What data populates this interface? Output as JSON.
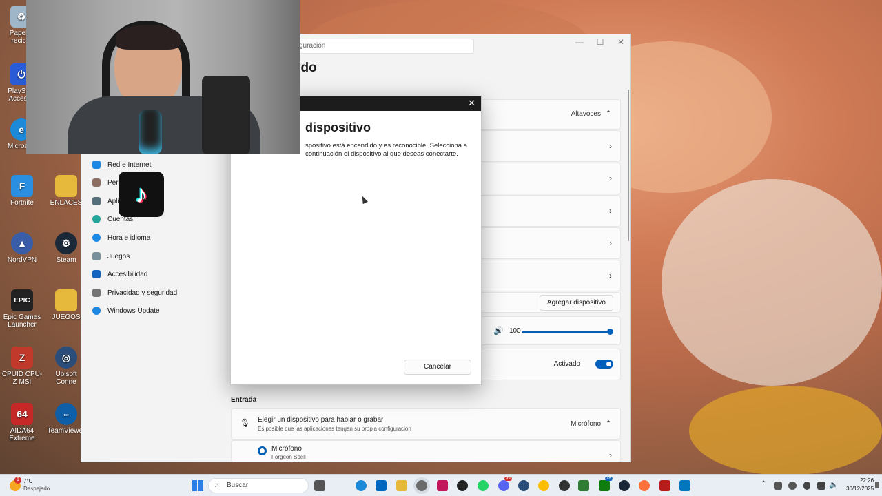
{
  "desktop": {
    "icons": [
      {
        "label": "Papelera de reciclaje",
        "short": "Papeler reciclá",
        "color": "#9fb6c9"
      },
      {
        "label": "PlayStation Accessories",
        "short": "PlayStati Accessc",
        "color": "#2a5bd7"
      },
      {
        "label": "Microsoft Edge",
        "short": "Microsofl",
        "color": "#1c8ad9"
      },
      {
        "label": "Fortnite",
        "short": "Fortnite",
        "color": "#2a8fe0"
      },
      {
        "label": "ENLACES",
        "short": "ENLACES",
        "color": "#e6b93d"
      },
      {
        "label": "NordVPN",
        "short": "NordVPN",
        "color": "#3a5da8"
      },
      {
        "label": "Steam",
        "short": "Steam",
        "color": "#1b2838"
      },
      {
        "label": "Epic Games Launcher",
        "short": "Epic Games Launcher",
        "color": "#222222"
      },
      {
        "label": "JUEGOS",
        "short": "JUEGOS",
        "color": "#e6b93d"
      },
      {
        "label": "CPUID CPU-Z MSI",
        "short": "CPUID CPU-Z MSI",
        "color": "#c0392b"
      },
      {
        "label": "Ubisoft Connect",
        "short": "Ubisoft Conne",
        "color": "#2b4d7a"
      },
      {
        "label": "AIDA64 Extreme",
        "short": "AIDA64 Extreme",
        "color": "#c62828"
      },
      {
        "label": "TeamViewer",
        "short": "TeamViewer",
        "color": "#0e5ea8"
      }
    ]
  },
  "settings": {
    "search_placeholder": "figuración",
    "page_title": "onido",
    "nav_items": [
      {
        "label": "Red e Internet",
        "color": "#1e88e5"
      },
      {
        "label": "Pers",
        "color": "#8d6e63"
      },
      {
        "label": "Aplic",
        "color": "#546e7a"
      },
      {
        "label": "Cuentas",
        "color": "#26a69a"
      },
      {
        "label": "Hora e idioma",
        "color": "#1e88e5"
      },
      {
        "label": "Juegos",
        "color": "#78909c"
      },
      {
        "label": "Accesibilidad",
        "color": "#1565c0"
      },
      {
        "label": "Privacidad y seguridad",
        "color": "#757575"
      },
      {
        "label": "Windows Update",
        "color": "#1e88e5"
      }
    ],
    "output_header_value": "Altavoces",
    "add_device_button": "Agregar dispositivo",
    "volume_value": "100",
    "toggle_label": "Activado",
    "input_section_title": "Entrada",
    "input_device_title": "Elegir un dispositivo para hablar o grabar",
    "input_device_subtitle": "Es posible que las aplicaciones tengan su propia configuración",
    "input_device_value": "Micrófono",
    "mic_name": "Micrófono",
    "mic_sub": "Forgeon Spell"
  },
  "dialog": {
    "title": "dispositivo",
    "description": "spositivo está encendido y es reconocible. Selecciona a continuación el dispositivo al que deseas conectarte.",
    "cancel_label": "Cancelar"
  },
  "taskbar": {
    "weather_temp": "7°C",
    "weather_desc": "Despejado",
    "weather_badge": "1",
    "search_label": "Buscar",
    "time": "22:26",
    "date": "30/12/2025",
    "badge_a": "99",
    "badge_b": "18"
  },
  "colors": {
    "accent": "#005fb8",
    "dialog_bar": "#1c1c1c",
    "taskbar": "#e9eef4"
  }
}
